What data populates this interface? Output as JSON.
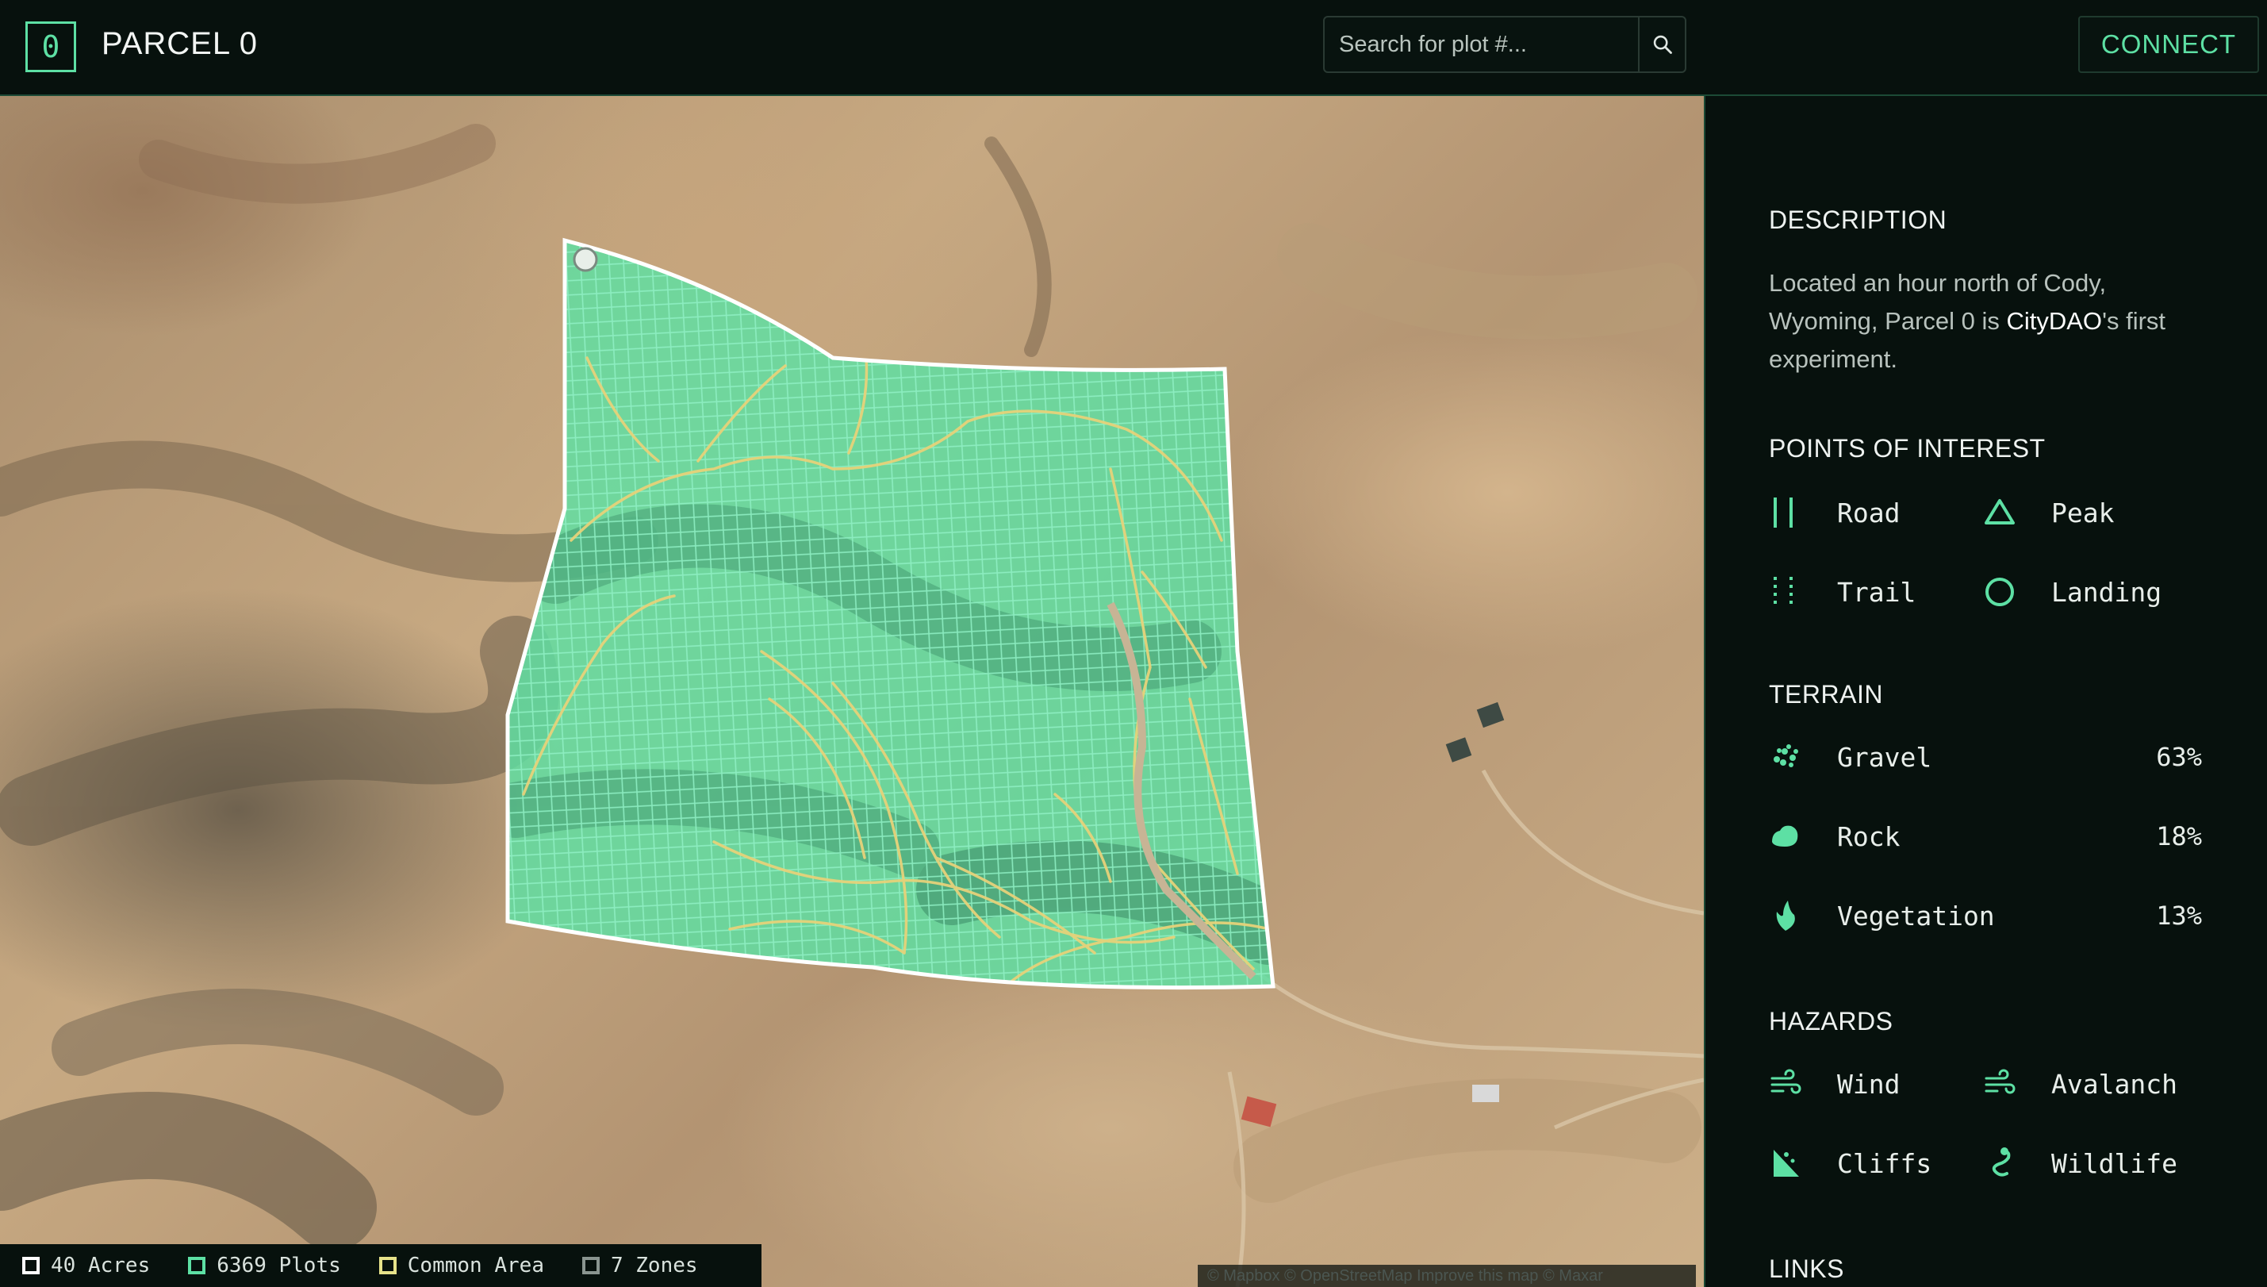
{
  "header": {
    "logo_glyph": "0",
    "title": "PARCEL 0",
    "search_placeholder": "Search for plot #...",
    "connect_label": "CONNECT"
  },
  "map": {
    "stats": [
      {
        "label": "40 Acres",
        "color": "#ffffff"
      },
      {
        "label": "6369 Plots",
        "color": "#5de0a4"
      },
      {
        "label": "Common Area",
        "color": "#e6e28a"
      },
      {
        "label": "7 Zones",
        "color": "#8a9590"
      }
    ],
    "attribution": "© Mapbox © OpenStreetMap Improve this map © Maxar",
    "parcel_fill": "#5de0a4",
    "trail_color": "#e6d27a"
  },
  "sidebar": {
    "description_title": "DESCRIPTION",
    "description_before": "Located an hour north of Cody, Wyoming, Parcel 0 is ",
    "description_highlight": "CityDAO",
    "description_after": "'s first experiment.",
    "poi_title": "POINTS OF INTEREST",
    "poi": [
      {
        "label": "Road",
        "icon": "road-icon"
      },
      {
        "label": "Peak",
        "icon": "peak-icon"
      },
      {
        "label": "Trail",
        "icon": "trail-icon"
      },
      {
        "label": "Landing",
        "icon": "landing-icon"
      }
    ],
    "terrain_title": "TERRAIN",
    "terrain": [
      {
        "label": "Gravel",
        "value": "63%",
        "icon": "gravel-icon"
      },
      {
        "label": "Rock",
        "value": "18%",
        "icon": "rock-icon"
      },
      {
        "label": "Vegetation",
        "value": "13%",
        "icon": "vegetation-icon"
      }
    ],
    "hazards_title": "HAZARDS",
    "hazards": [
      {
        "label": "Wind",
        "icon": "wind-icon"
      },
      {
        "label": "Avalanch",
        "icon": "avalanche-icon"
      },
      {
        "label": "Cliffs",
        "icon": "cliffs-icon"
      },
      {
        "label": "Wildlife",
        "icon": "wildlife-icon"
      }
    ],
    "links_title": "LINKS",
    "accent": "#5de0a4"
  }
}
